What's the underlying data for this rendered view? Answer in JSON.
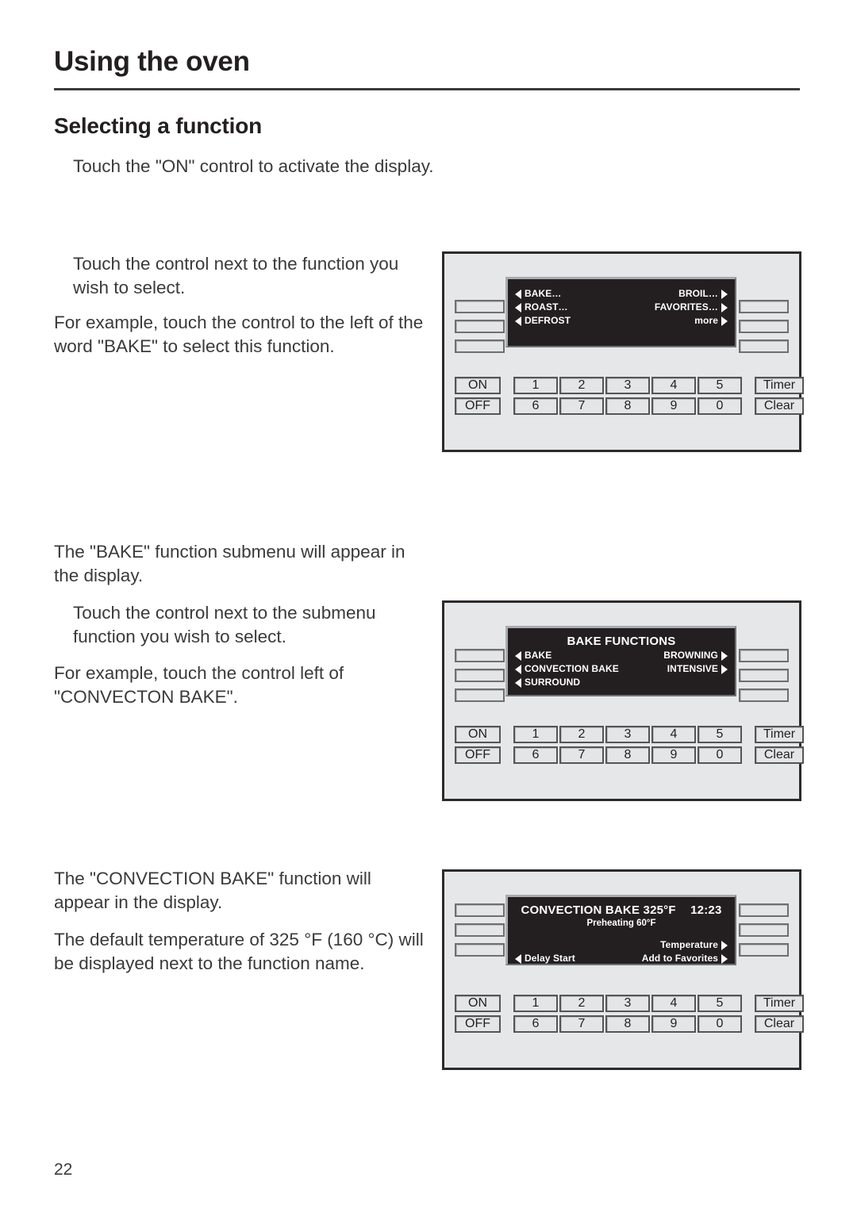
{
  "header": {
    "chapter_title": "Using the oven",
    "section_title": "Selecting a function"
  },
  "body": {
    "p1": "Touch the \"ON\" control to activate the display.",
    "p2": "Touch the control next to the function you wish to select.",
    "p3": "For example, touch the control to the left of the word \"BAKE\" to select this function.",
    "p4": "The \"BAKE\" function submenu will appear in the display.",
    "p5": "Touch the control next to the submenu function you wish to select.",
    "p6": "For example, touch the control left of \"CONVECTON BAKE\".",
    "p7": "The \"CONVECTION BAKE\" function will appear in the display.",
    "p8": "The default temperature of 325 °F (160 °C) will be displayed next to the function name."
  },
  "keypad": {
    "on_label": "ON",
    "off_label": "OFF",
    "timer_label": "Timer",
    "clear_label": "Clear",
    "row1": [
      "1",
      "2",
      "3",
      "4",
      "5"
    ],
    "row2": [
      "6",
      "7",
      "8",
      "9",
      "0"
    ]
  },
  "panels": [
    {
      "name": "main-function-menu",
      "display": {
        "title": "",
        "subtitle": "",
        "rows": [
          {
            "left": "BAKE…",
            "right": "BROIL…"
          },
          {
            "left": "ROAST…",
            "right": "FAVORITES…"
          },
          {
            "left": "DEFROST",
            "right": "more"
          }
        ]
      }
    },
    {
      "name": "bake-functions-submenu",
      "display": {
        "title": "BAKE FUNCTIONS",
        "subtitle": "",
        "rows": [
          {
            "left": "BAKE",
            "right": "BROWNING"
          },
          {
            "left": "CONVECTION BAKE",
            "right": "INTENSIVE"
          },
          {
            "left": "SURROUND",
            "right": ""
          }
        ]
      }
    },
    {
      "name": "convection-bake-active",
      "display": {
        "title": "CONVECTION BAKE 325°F  12:23",
        "subtitle": "Preheating 60°F",
        "rows": [
          {
            "left": "",
            "right": ""
          },
          {
            "left": "",
            "right": "Temperature"
          },
          {
            "left": "Delay Start",
            "right": "Add to Favorites"
          }
        ]
      }
    }
  ],
  "footer": {
    "page_number": "22"
  },
  "colors": {
    "panel_bg": "#e6e7e8",
    "panel_border": "#2b2b2b",
    "lcd_bg": "#231f20",
    "text": "#3a3a3c"
  }
}
